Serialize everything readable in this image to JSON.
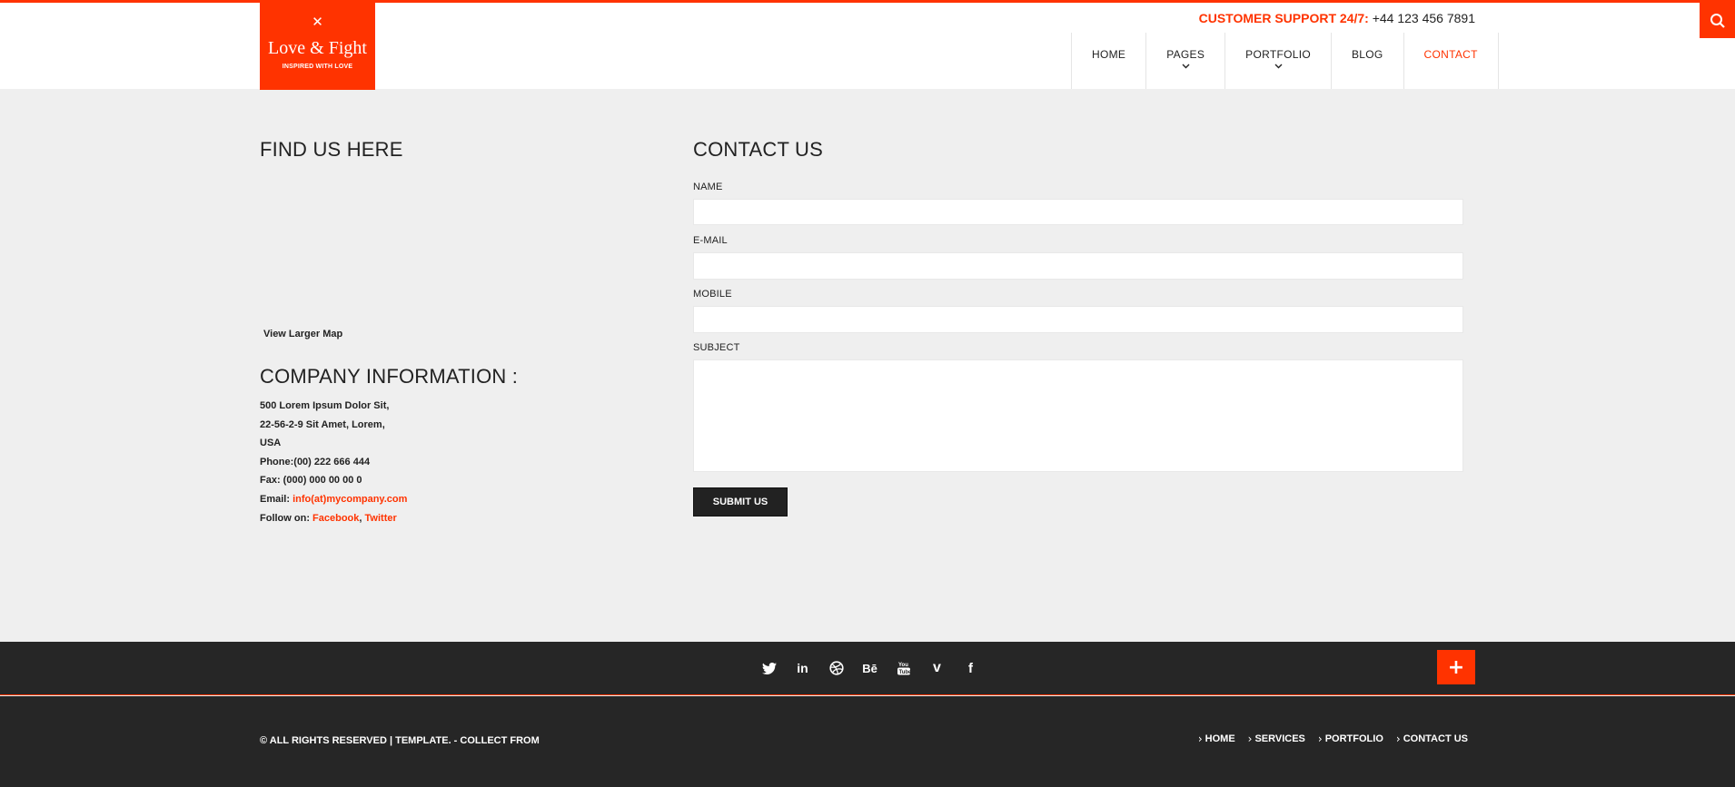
{
  "header": {
    "logo": {
      "mark": "✕",
      "brand": "Love & Fight",
      "tagline": "INSPIRED WITH LOVE"
    },
    "support_label": "CUSTOMER SUPPORT 24/7:",
    "support_phone": " +44 123 456 7891",
    "search_icon": "search-icon"
  },
  "nav": {
    "items": [
      {
        "label": "HOME"
      },
      {
        "label": "PAGES"
      },
      {
        "label": "PORTFOLIO"
      },
      {
        "label": "BLOG"
      },
      {
        "label": "CONTACT"
      }
    ]
  },
  "find_us": {
    "title": "FIND US HERE",
    "view_map": "View Larger Map"
  },
  "company": {
    "title": "COMPANY INFORMATION :",
    "address1": "500 Lorem Ipsum Dolor Sit,",
    "address2": "22-56-2-9 Sit Amet, Lorem,",
    "address3": "USA",
    "phone": "Phone:(00) 222 666 444",
    "fax": "Fax: (000) 000 00 00 0",
    "email_label": "Email: ",
    "email": "info(at)mycompany.com",
    "follow_label": "Follow on: ",
    "facebook": "Facebook",
    "comma": ", ",
    "twitter": "Twitter"
  },
  "contact": {
    "title": "CONTACT US",
    "name_label": "NAME",
    "email_label": "E-MAIL",
    "mobile_label": "MOBILE",
    "subject_label": "SUBJECT",
    "name_value": "",
    "email_value": "",
    "mobile_value": "",
    "subject_value": "",
    "submit": "SUBMIT US"
  },
  "footer": {
    "social": [
      "twitter-icon",
      "linkedin-icon",
      "dribbble-icon",
      "behance-icon",
      "youtube-icon",
      "vimeo-icon",
      "facebook-icon"
    ],
    "plus": "+",
    "copyright": "© ALL RIGHTS RESERVED | TEMPLATE. - COLLECT FROM",
    "links": [
      {
        "label": "HOME"
      },
      {
        "label": "SERVICES"
      },
      {
        "label": "PORTFOLIO"
      },
      {
        "label": "CONTACT US"
      }
    ]
  },
  "colors": {
    "accent": "#ff3300",
    "dark": "#262626",
    "background": "#efefef"
  }
}
